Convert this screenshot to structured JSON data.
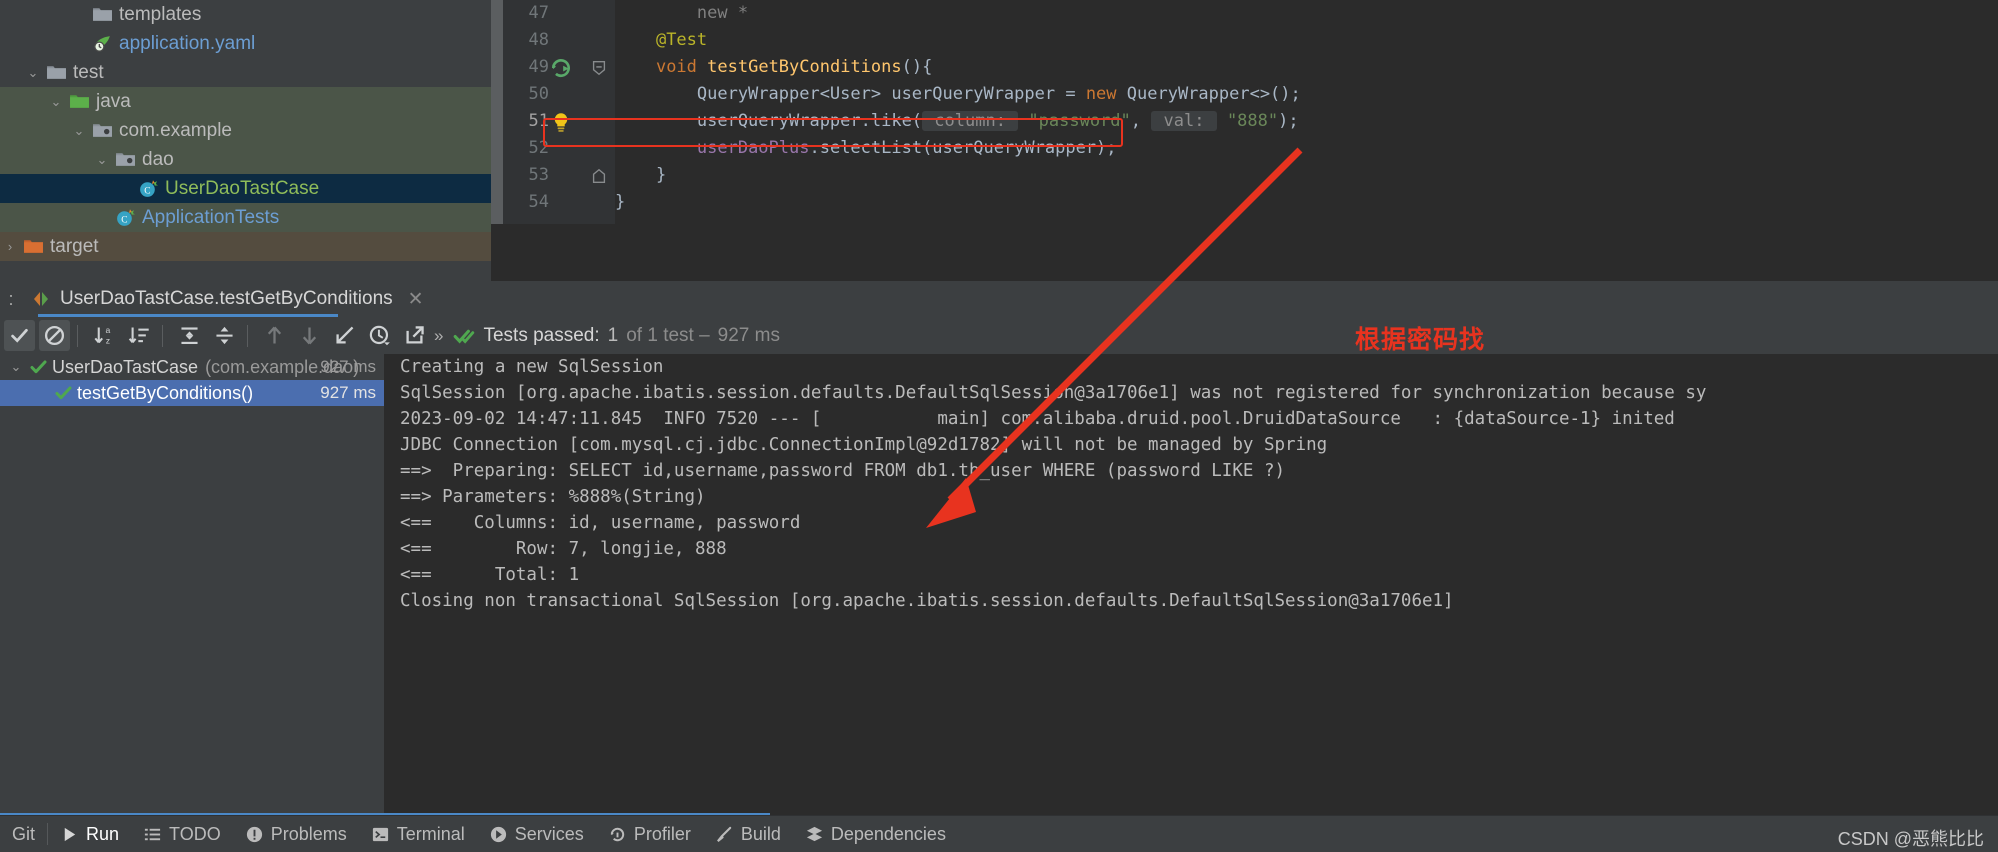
{
  "project_tree": {
    "rows": [
      {
        "indent": 3,
        "arrow": "",
        "icon": "folder-gray-icon",
        "label": "templates",
        "color": "#bbbbbb",
        "scope": "none"
      },
      {
        "indent": 3,
        "arrow": "",
        "icon": "yaml-file-icon",
        "label": "application.yaml",
        "color": "#6c9ed3",
        "scope": "none"
      },
      {
        "indent": 1,
        "arrow": "v",
        "icon": "folder-gray-icon",
        "label": "test",
        "color": "#bbbbbb",
        "scope": "none"
      },
      {
        "indent": 2,
        "arrow": "v",
        "icon": "folder-green-icon",
        "label": "java",
        "color": "#bbbbbb",
        "scope": "test"
      },
      {
        "indent": 3,
        "arrow": "v",
        "icon": "package-icon",
        "label": "com.example",
        "color": "#bbbbbb",
        "scope": "test"
      },
      {
        "indent": 4,
        "arrow": "v",
        "icon": "package-icon",
        "label": "dao",
        "color": "#bbbbbb",
        "scope": "test"
      },
      {
        "indent": 5,
        "arrow": "",
        "icon": "java-test-class-icon",
        "label": "UserDaoTastCase",
        "color": "#8fbc5a",
        "scope": "selected"
      },
      {
        "indent": 4,
        "arrow": "",
        "icon": "java-test-class-icon",
        "label": "ApplicationTests",
        "color": "#6c9ed3",
        "scope": "test"
      },
      {
        "indent": 0,
        "arrow": ">",
        "icon": "folder-orange-icon",
        "label": "target",
        "color": "#bbbbbb",
        "scope": "target"
      }
    ]
  },
  "editor": {
    "lines": [
      {
        "number": "47",
        "current": false,
        "gutter_icon": "",
        "fold": "",
        "tokens": [
          {
            "t": "        ",
            "c": "c-plain"
          },
          {
            "t": "new *",
            "c": "c-comment"
          }
        ]
      },
      {
        "number": "48",
        "current": false,
        "gutter_icon": "",
        "fold": "",
        "tokens": [
          {
            "t": "    ",
            "c": "c-plain"
          },
          {
            "t": "@Test",
            "c": "c-ann"
          }
        ]
      },
      {
        "number": "49",
        "current": false,
        "gutter_icon": "run-test-icon",
        "fold": "minus",
        "tokens": [
          {
            "t": "    ",
            "c": "c-plain"
          },
          {
            "t": "void",
            "c": "c-kw"
          },
          {
            "t": " ",
            "c": "c-plain"
          },
          {
            "t": "testGetByConditions",
            "c": "c-meth"
          },
          {
            "t": "(){",
            "c": "c-plain"
          }
        ]
      },
      {
        "number": "50",
        "current": false,
        "gutter_icon": "",
        "fold": "",
        "tokens": [
          {
            "t": "        QueryWrapper<User> userQueryWrapper = ",
            "c": "c-plain"
          },
          {
            "t": "new",
            "c": "c-kw"
          },
          {
            "t": " QueryWrapper<>();",
            "c": "c-plain"
          }
        ]
      },
      {
        "number": "51",
        "current": true,
        "gutter_icon": "intention-bulb-icon",
        "fold": "",
        "tokens": [
          {
            "t": "        userQueryWrapper.like(",
            "c": "c-plain"
          },
          {
            "t": " column: ",
            "c": "c-hint"
          },
          {
            "t": " ",
            "c": "c-plain"
          },
          {
            "t": "\"password\"",
            "c": "c-str"
          },
          {
            "t": ", ",
            "c": "c-plain"
          },
          {
            "t": " val: ",
            "c": "c-hint"
          },
          {
            "t": " ",
            "c": "c-plain"
          },
          {
            "t": "\"888\"",
            "c": "c-str"
          },
          {
            "t": ");",
            "c": "c-plain"
          }
        ]
      },
      {
        "number": "52",
        "current": false,
        "gutter_icon": "",
        "fold": "",
        "tokens": [
          {
            "t": "        ",
            "c": "c-plain"
          },
          {
            "t": "userDaoPlus",
            "c": "c-field"
          },
          {
            "t": ".selectList(userQueryWrapper);",
            "c": "c-plain"
          }
        ]
      },
      {
        "number": "53",
        "current": false,
        "gutter_icon": "",
        "fold": "end",
        "tokens": [
          {
            "t": "    }",
            "c": "c-plain"
          }
        ]
      },
      {
        "number": "54",
        "current": false,
        "gutter_icon": "",
        "fold": "",
        "tokens": [
          {
            "t": "}",
            "c": "c-plain"
          }
        ]
      }
    ]
  },
  "run_tab": {
    "prefix": ":",
    "label": "UserDaoTastCase.testGetByConditions",
    "close": "✕",
    "icon": "run-config-icon"
  },
  "test_toolbar": {
    "buttons": [
      {
        "name": "show-passed-toggle",
        "icon": "check-icon",
        "active": true
      },
      {
        "name": "show-ignored-toggle",
        "icon": "ban-icon",
        "active": true
      },
      {
        "name": "sort-alphabetically-button",
        "icon": "sort-az-icon",
        "active": false
      },
      {
        "name": "sort-by-duration-button",
        "icon": "sort-duration-icon",
        "active": false
      },
      {
        "name": "expand-all-button",
        "icon": "expand-all-icon",
        "active": false
      },
      {
        "name": "collapse-all-button",
        "icon": "collapse-all-icon",
        "active": false
      },
      {
        "name": "previous-failed-test-button",
        "icon": "arrow-up-icon",
        "active": false
      },
      {
        "name": "next-failed-test-button",
        "icon": "arrow-down-icon",
        "active": false
      },
      {
        "name": "scroll-to-source-button",
        "icon": "scroll-to-source-icon",
        "active": false
      },
      {
        "name": "test-history-button",
        "icon": "clock-history-icon",
        "active": false
      },
      {
        "name": "export-results-button",
        "icon": "export-icon",
        "active": false
      }
    ],
    "more": "»",
    "status": {
      "icon": "double-check-green-icon",
      "prefix": "Tests passed:",
      "count": "1",
      "suffix": "of 1 test –",
      "duration": "927 ms"
    }
  },
  "test_tree": {
    "rows": [
      {
        "indent": 0,
        "arrow": "v",
        "icon": "check-green-icon",
        "name": "UserDaoTastCase",
        "package": "(com.example.dao)",
        "time": "927 ms",
        "selected": false
      },
      {
        "indent": 1,
        "arrow": "",
        "icon": "check-green-icon",
        "name": "testGetByConditions()",
        "package": "",
        "time": "927 ms",
        "selected": true
      }
    ]
  },
  "console": {
    "lines": [
      "Creating a new SqlSession",
      "SqlSession [org.apache.ibatis.session.defaults.DefaultSqlSession@3a1706e1] was not registered for synchronization because sy",
      "2023-09-02 14:47:11.845  INFO 7520 --- [           main] com.alibaba.druid.pool.DruidDataSource   : {dataSource-1} inited",
      "JDBC Connection [com.mysql.cj.jdbc.ConnectionImpl@92d1782] will not be managed by Spring",
      "==>  Preparing: SELECT id,username,password FROM db1.tb_user WHERE (password LIKE ?)",
      "==> Parameters: %888%(String)",
      "<==    Columns: id, username, password",
      "<==        Row: 7, longjie, 888",
      "<==      Total: 1",
      "Closing non transactional SqlSession [org.apache.ibatis.session.defaults.DefaultSqlSession@3a1706e1]"
    ]
  },
  "annotation": {
    "text": "根据密码找",
    "color": "#e8331f"
  },
  "status_bar": {
    "items": [
      {
        "name": "status-git",
        "icon": "",
        "label": "Git",
        "active": false
      },
      {
        "name": "status-run",
        "icon": "play-icon",
        "label": "Run",
        "active": true
      },
      {
        "name": "status-todo",
        "icon": "todo-list-icon",
        "label": "TODO",
        "active": false
      },
      {
        "name": "status-problems",
        "icon": "problems-icon",
        "label": "Problems",
        "active": false
      },
      {
        "name": "status-terminal",
        "icon": "terminal-icon",
        "label": "Terminal",
        "active": false
      },
      {
        "name": "status-services",
        "icon": "services-icon",
        "label": "Services",
        "active": false
      },
      {
        "name": "status-profiler",
        "icon": "profiler-icon",
        "label": "Profiler",
        "active": false
      },
      {
        "name": "status-build",
        "icon": "build-hammer-icon",
        "label": "Build",
        "active": false
      },
      {
        "name": "status-dependencies",
        "icon": "dependencies-icon",
        "label": "Dependencies",
        "active": false
      }
    ],
    "watermark": "CSDN @恶熊比比"
  },
  "colors": {
    "accent_blue": "#4a88c7",
    "selection_blue": "#4b6eaf",
    "annotation_red": "#e8331f",
    "editor_bg": "#2b2b2b",
    "panel_bg": "#3c3f41",
    "test_scope_green": "#4b5548",
    "string_green": "#6a8759",
    "keyword_orange": "#cc7832"
  }
}
